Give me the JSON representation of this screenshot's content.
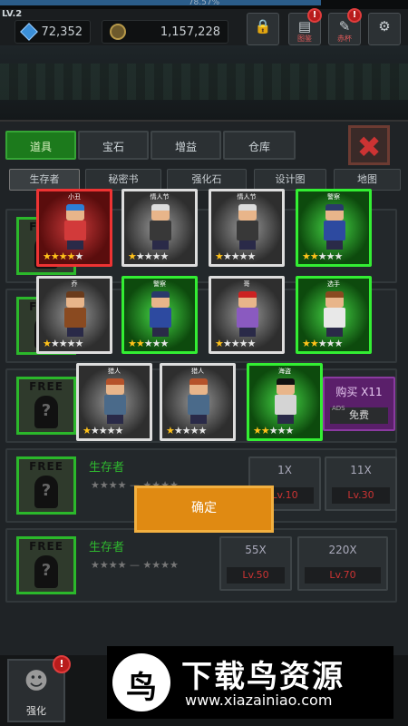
{
  "header": {
    "xp_text": "78.57%",
    "xp_fraction": 0.7857,
    "level": "LV.2",
    "gems": "72,352",
    "coins": "1,157,228",
    "buttons": [
      {
        "label": "",
        "icon": "lock-icon"
      },
      {
        "label": "图鉴",
        "icon": "book-icon",
        "badge": "!"
      },
      {
        "label": "赤杯",
        "icon": "wrench-icon",
        "badge": "!"
      },
      {
        "label": "",
        "icon": "gear-icon"
      }
    ]
  },
  "tabs": [
    {
      "label": "道具",
      "active": true
    },
    {
      "label": "宝石",
      "active": false
    },
    {
      "label": "增益",
      "active": false
    },
    {
      "label": "仓库",
      "active": false
    }
  ],
  "subtabs": [
    {
      "label": "生存者",
      "active": true
    },
    {
      "label": "秘密书",
      "active": false
    },
    {
      "label": "强化石",
      "active": false
    },
    {
      "label": "设计图",
      "active": false
    },
    {
      "label": "地图",
      "active": false
    }
  ],
  "rows": [
    {
      "free": "FREE",
      "label": "",
      "buy": []
    },
    {
      "free": "FREE",
      "label": "",
      "buy": []
    },
    {
      "free": "FREE",
      "label": "",
      "buy": [
        {
          "count": "购买 X11",
          "ads_tag": "ADS",
          "action": "免费",
          "style": "purple"
        }
      ]
    },
    {
      "free": "FREE",
      "label": "生存者",
      "stars": "★★★★ — ★★★★",
      "buy": [
        {
          "count": "1X",
          "lock": "Lv.10"
        },
        {
          "count": "11X",
          "lock": "Lv.30"
        }
      ]
    },
    {
      "free": "FREE",
      "label": "生存者",
      "stars": "★★★★ — ★★★★",
      "buy": [
        {
          "count": "55X",
          "lock": "Lv.50"
        },
        {
          "count": "220X",
          "lock": "Lv.70"
        }
      ]
    }
  ],
  "cards": [
    {
      "name": "小丑",
      "rarity": "red",
      "stars": 4,
      "hair": "#2d7ed6",
      "shirt": "#d23a3a"
    },
    {
      "name": "情人节",
      "rarity": "white",
      "stars": 1,
      "hair": "#dcdcdc",
      "shirt": "#383838"
    },
    {
      "name": "情人节",
      "rarity": "white",
      "stars": 1,
      "hair": "#dcdcdc",
      "shirt": "#383838"
    },
    {
      "name": "警察",
      "rarity": "green",
      "stars": 2,
      "hair": "#2a3a6a",
      "shirt": "#2d4aa0"
    },
    {
      "name": "乔",
      "rarity": "white",
      "stars": 1,
      "hair": "#6a3b1c",
      "shirt": "#8a4a20"
    },
    {
      "name": "警察",
      "rarity": "green",
      "stars": 2,
      "hair": "#2a3a6a",
      "shirt": "#2d4aa0"
    },
    {
      "name": "哥",
      "rarity": "white",
      "stars": 1,
      "hair": "#c22",
      "shirt": "#8a5ac0"
    },
    {
      "name": "选手",
      "rarity": "green",
      "stars": 2,
      "hair": "#8a4a20",
      "shirt": "#e8e8e8"
    },
    {
      "name": "猎人",
      "rarity": "white",
      "stars": 1,
      "hair": "#b5522a",
      "shirt": "#4a6a8a"
    },
    {
      "name": "猎人",
      "rarity": "white",
      "stars": 1,
      "hair": "#b5522a",
      "shirt": "#4a6a8a"
    },
    {
      "name": "海盗",
      "rarity": "green",
      "stars": 2,
      "hair": "#111",
      "shirt": "#d4d4d4"
    }
  ],
  "confirm_label": "确定",
  "bottom": {
    "button_label": "强化",
    "badge": "!"
  },
  "watermark": {
    "logo_char": "鸟",
    "title": "下载鸟资源",
    "url": "www.xiazainiao.com"
  }
}
